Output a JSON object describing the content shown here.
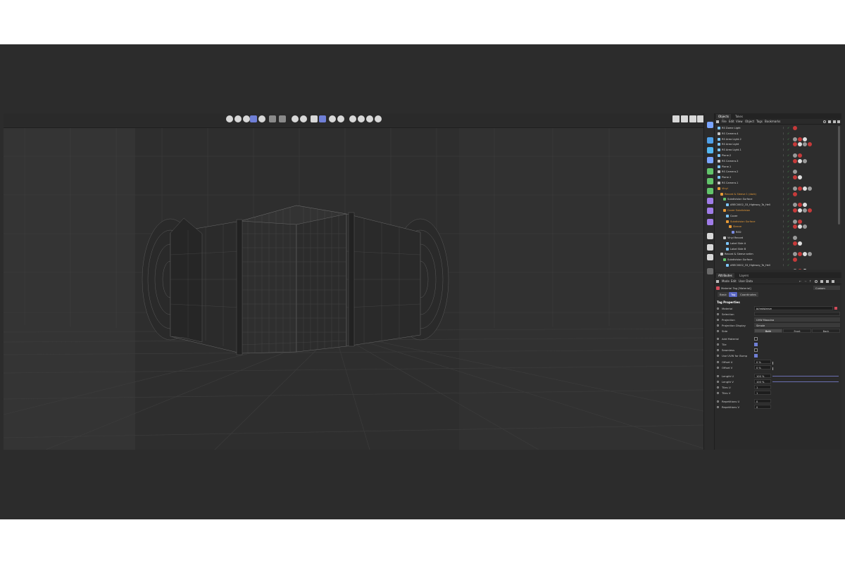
{
  "panel": {
    "top_tabs": [
      "Objects",
      "Takes"
    ],
    "menu": [
      "File",
      "Edit",
      "View",
      "Object",
      "Tags",
      "Bookmarks"
    ],
    "objects": [
      {
        "name": "RS Dome Light",
        "indent": 0,
        "color": "#7cc7ff"
      },
      {
        "name": "RS Camera.4",
        "indent": 0,
        "color": "#c8c8c8"
      },
      {
        "name": "RS Area Light.2",
        "indent": 0,
        "color": "#7cc7ff"
      },
      {
        "name": "RS Area Light",
        "indent": 0,
        "color": "#7cc7ff"
      },
      {
        "name": "RS Area Light.1",
        "indent": 0,
        "color": "#7cc7ff"
      },
      {
        "name": "Plane.2",
        "indent": 0,
        "color": "#7cc7ff"
      },
      {
        "name": "RS Camera.3",
        "indent": 0,
        "color": "#c8c8c8"
      },
      {
        "name": "Plane.1",
        "indent": 0,
        "color": "#7cc7ff"
      },
      {
        "name": "RS Camera.2",
        "indent": 0,
        "color": "#c8c8c8"
      },
      {
        "name": "Plane.1",
        "indent": 0,
        "color": "#7cc7ff"
      },
      {
        "name": "RS Camera.1",
        "indent": 0,
        "color": "#c8c8c8"
      },
      {
        "name": "Vinyl",
        "indent": 0,
        "color": "#e79a36",
        "orange": true
      },
      {
        "name": "Record & Sleeve 1 (dark)",
        "indent": 1,
        "color": "#e79a36",
        "orange": true
      },
      {
        "name": "Subdivision Surface",
        "indent": 2,
        "color": "#62c46b"
      },
      {
        "name": "AREC0002_33_Highway_To_Hell",
        "indent": 3,
        "color": "#7cc7ff"
      },
      {
        "name": "Cover Subdivision",
        "indent": 2,
        "color": "#e79a36",
        "orange": true
      },
      {
        "name": "Cover",
        "indent": 3,
        "color": "#7cc7ff"
      },
      {
        "name": "Subdivision Surface",
        "indent": 3,
        "color": "#e79a36",
        "orange": true
      },
      {
        "name": "Sleeve",
        "indent": 4,
        "color": "#e79a36",
        "orange": true
      },
      {
        "name": "RED",
        "indent": 5,
        "color": "#7a8be0"
      },
      {
        "name": "Vinyl Record",
        "indent": 2,
        "color": "#c8c8c8"
      },
      {
        "name": "Label Side A",
        "indent": 3,
        "color": "#7cc7ff"
      },
      {
        "name": "Label Side B",
        "indent": 3,
        "color": "#7cc7ff"
      },
      {
        "name": "Record & Sleeve setim",
        "indent": 1,
        "color": "#c8c8c8"
      },
      {
        "name": "Subdivision Surface",
        "indent": 2,
        "color": "#62c46b"
      },
      {
        "name": "AREC0002_33_Highway_To_Hell",
        "indent": 3,
        "color": "#7cc7ff"
      },
      {
        "name": "Cover Subdivision",
        "indent": 2,
        "color": "#c8c8c8"
      }
    ],
    "attr_tabs": [
      "Attributes",
      "Layers"
    ],
    "attr_menu": [
      "Mode",
      "Edit",
      "User Data"
    ],
    "attr_title": "Material Tag [Material]",
    "attr_dropdown": "Custom",
    "sub_tabs": [
      "Basic",
      "Tag",
      "Coordinates"
    ],
    "section": "Tag Properties",
    "material_label": "Material",
    "material_value": "bl/redsleeve",
    "selection_label": "Selection",
    "projection_label": "Projection",
    "projection_value": "UVW Mapping",
    "projection_display_label": "Projection Display",
    "projection_display_value": "Simple",
    "side_label": "Side",
    "side_options": [
      "Both",
      "Front",
      "Back"
    ],
    "checks": [
      {
        "label": "Add Material",
        "on": false
      },
      {
        "label": "Tile",
        "on": true
      },
      {
        "label": "Seamless",
        "on": false
      },
      {
        "label": "Use UVW for Bump",
        "on": true
      }
    ],
    "offset_u_label": "Offset U",
    "offset_u": "0 %",
    "offset_v_label": "Offset V",
    "offset_v": "0 %",
    "length_u_label": "Length U",
    "length_u": "100 %",
    "length_v_label": "Length V",
    "length_v": "100 %",
    "tiles_u_label": "Tiles U",
    "tiles_u": "1",
    "tiles_v_label": "Tiles V",
    "tiles_v": "1",
    "rep_u_label": "Repetitions U",
    "rep_u": "0",
    "rep_v_label": "Repetitions V",
    "rep_v": "0"
  }
}
